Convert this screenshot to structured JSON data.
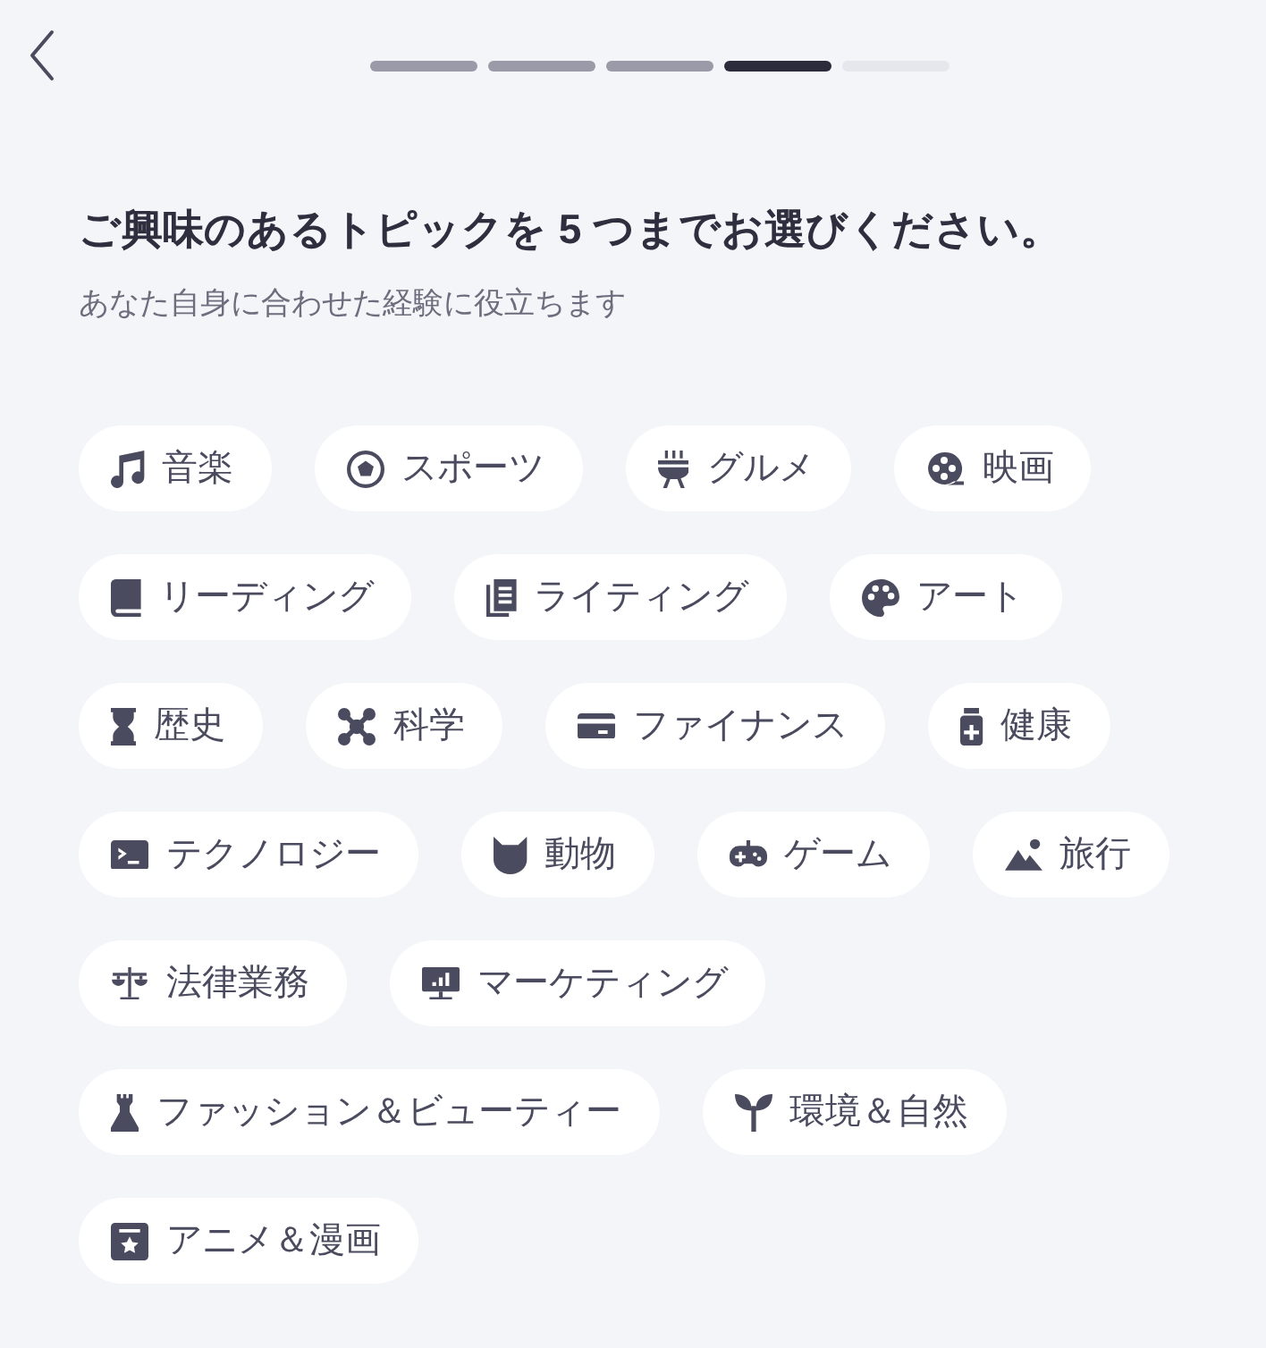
{
  "progress": {
    "steps": [
      {
        "selected": false
      },
      {
        "selected": false
      },
      {
        "selected": false
      },
      {
        "selected": true
      },
      {
        "selected": false
      }
    ]
  },
  "heading": "ご興味のあるトピックを 5 つまでお選びください。",
  "subheading": "あなた自身に合わせた経験に役立ちます",
  "topics": [
    {
      "label": "音楽",
      "selected": false
    },
    {
      "label": "スポーツ",
      "selected": false
    },
    {
      "label": "グルメ",
      "selected": false
    },
    {
      "label": "映画",
      "selected": false
    },
    {
      "label": "リーディング",
      "selected": false
    },
    {
      "label": "ライティング",
      "selected": false
    },
    {
      "label": "アート",
      "selected": false
    },
    {
      "label": "歴史",
      "selected": false
    },
    {
      "label": "科学",
      "selected": false
    },
    {
      "label": "ファイナンス",
      "selected": false
    },
    {
      "label": "健康",
      "selected": false
    },
    {
      "label": "テクノロジー",
      "selected": false
    },
    {
      "label": "動物",
      "selected": false
    },
    {
      "label": "ゲーム",
      "selected": false
    },
    {
      "label": "旅行",
      "selected": false
    },
    {
      "label": "法律業務",
      "selected": false
    },
    {
      "label": "マーケティング",
      "selected": false
    },
    {
      "label": "ファッション＆ビューティー",
      "selected": false
    },
    {
      "label": "環境＆自然",
      "selected": false
    },
    {
      "label": "アニメ＆漫画",
      "selected": false
    }
  ]
}
